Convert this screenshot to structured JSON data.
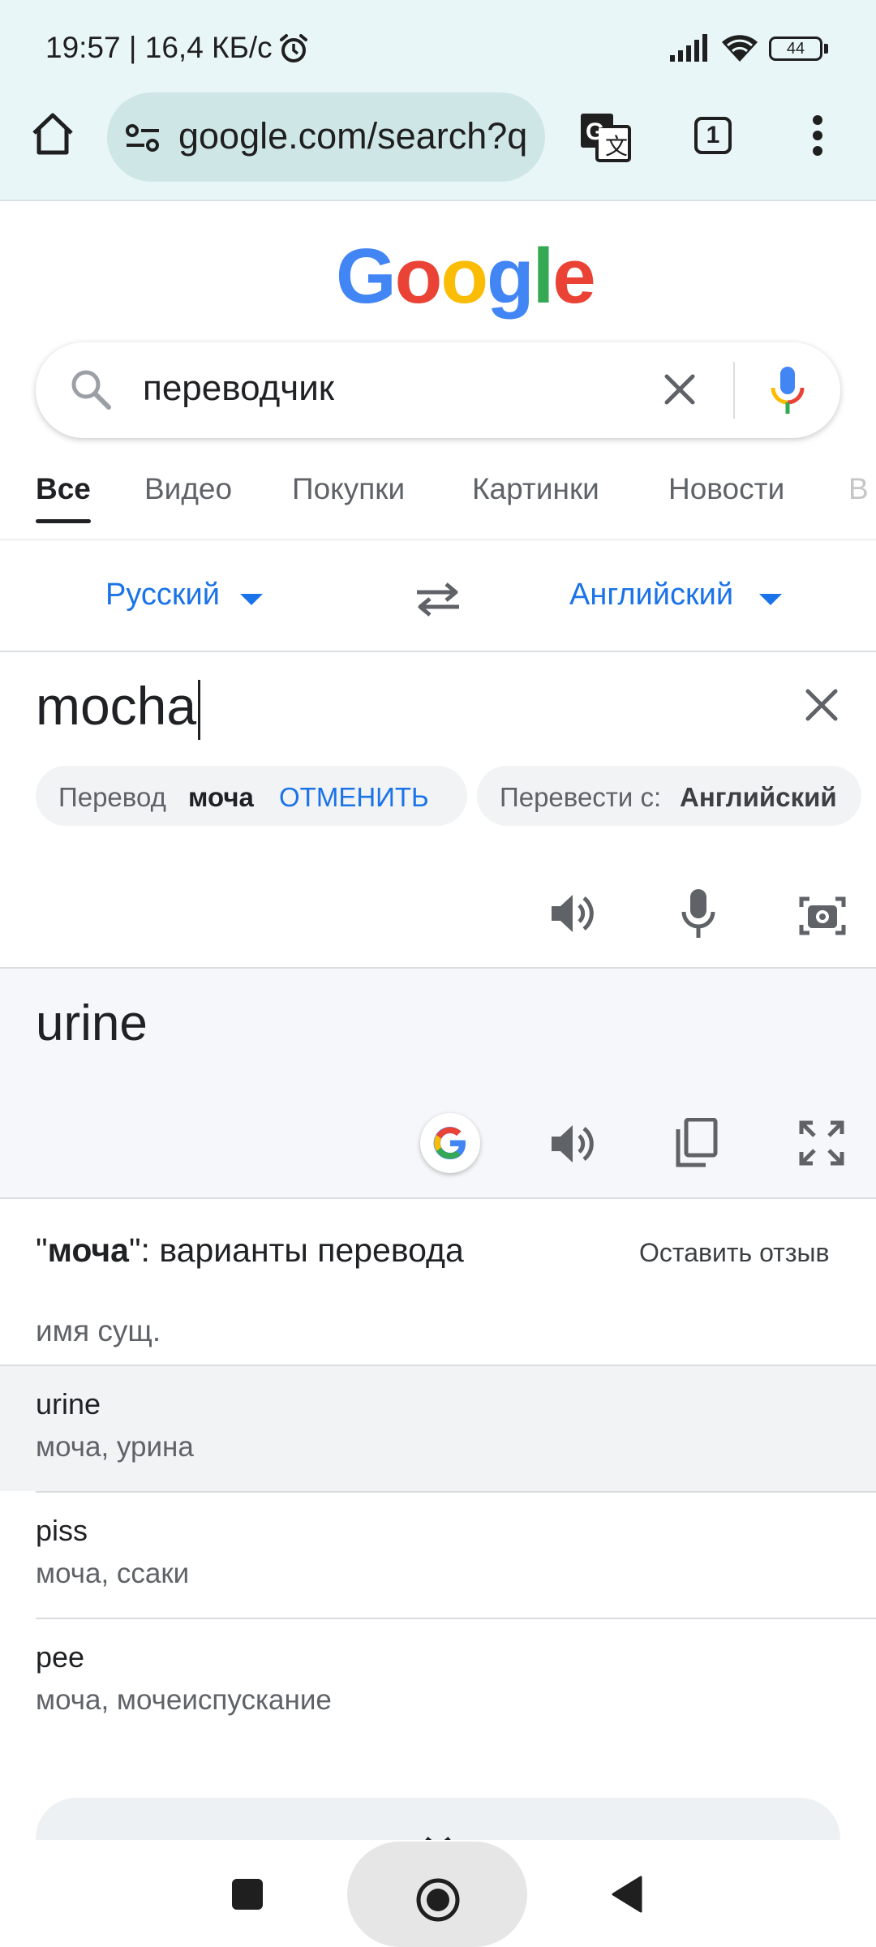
{
  "status_bar": {
    "time": "19:57 | 16,4 КБ/с",
    "battery": "44"
  },
  "browser": {
    "url": "google.com/search?q",
    "tab_count": "1"
  },
  "google": {
    "search_query": "переводчик",
    "tabs": [
      "Все",
      "Видео",
      "Покупки",
      "Картинки",
      "Новости",
      "В"
    ]
  },
  "translator": {
    "source_lang": "Русский",
    "target_lang": "Английский",
    "source_text": "mocha",
    "chip_prefix": "Перевод",
    "chip_word": "моча",
    "chip_undo": "ОТМЕНИТЬ",
    "chip2_prefix": "Перевести с:",
    "chip2_lang": "Английский",
    "result": "urine",
    "alts_title_quote_open": "\"",
    "alts_title_word": "моча",
    "alts_title_rest": "\": варианты перевода",
    "feedback": "Оставить отзыв",
    "pos": "имя сущ.",
    "alternatives": [
      {
        "word": "urine",
        "synonyms": "моча, урина"
      },
      {
        "word": "piss",
        "synonyms": "моча, ссаки"
      },
      {
        "word": "pee",
        "synonyms": "моча, мочеиспускание"
      }
    ]
  },
  "colors": {
    "blue": "#4285F4",
    "red": "#EA4335",
    "yellow": "#FBBC05",
    "green": "#34A853",
    "link": "#1a73e8"
  }
}
